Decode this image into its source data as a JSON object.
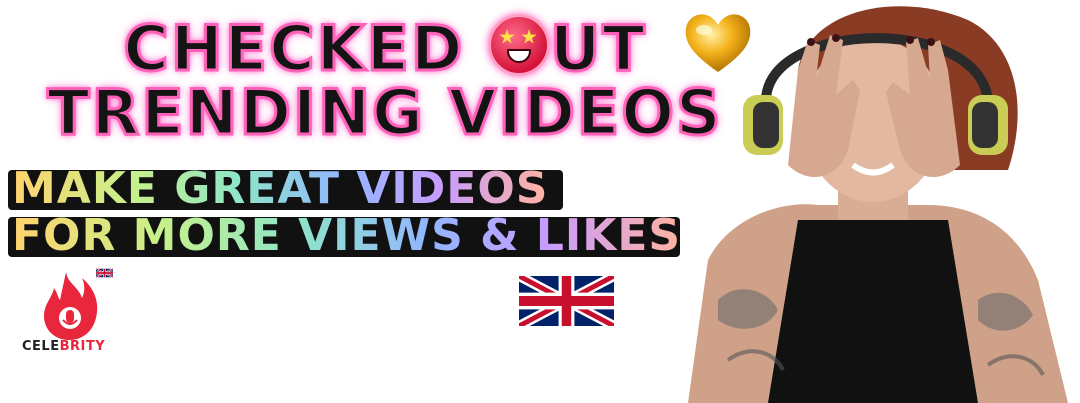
{
  "headline": {
    "line1_before": "CHECKED",
    "line1_after": "UT",
    "line2": "TRENDING VIDEOS"
  },
  "tagline": {
    "line1": "MAKE GREAT VIDEOS",
    "line2": "FOR MORE VIEWS & LIKES"
  },
  "logo": {
    "text_part1": "CELE",
    "text_part2": "BRITY"
  },
  "colors": {
    "headline_glow": "#ff61b8",
    "logo_red": "#e8263c",
    "flag_blue": "#012169",
    "flag_red": "#C8102E"
  },
  "icons": [
    "star-struck-emoji-icon",
    "gold-heart-icon",
    "flame-microphone-logo-icon",
    "uk-flag-icon"
  ]
}
